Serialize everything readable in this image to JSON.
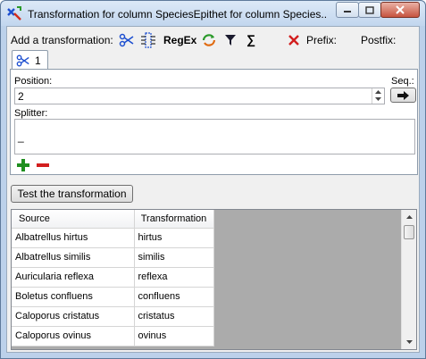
{
  "window": {
    "title": "Transformation for column SpeciesEpithet for column Species..."
  },
  "toolbar": {
    "add_label": "Add a transformation:",
    "icons": [
      "split-icon",
      "insert-column-icon",
      "regex",
      "replace-icon",
      "filter-icon",
      "sum-icon",
      "delete-icon"
    ],
    "regex_label": "RegEx",
    "sum_label": "∑",
    "prefix_label": "Prefix:",
    "postfix_label": "Postfix:"
  },
  "tab": {
    "label": "1"
  },
  "form": {
    "position_label": "Position:",
    "position_value": "2",
    "sequence_label": "Seq.:",
    "splitter_label": "Splitter:",
    "splitter_value": "_"
  },
  "actions": {
    "test_label": "Test the transformation"
  },
  "table": {
    "columns": [
      "Source",
      "Transformation"
    ],
    "rows": [
      [
        "Albatrellus hirtus",
        "hirtus"
      ],
      [
        "Albatrellus similis",
        "similis"
      ],
      [
        "Auricularia reflexa",
        "reflexa"
      ],
      [
        "Boletus confluens",
        "confluens"
      ],
      [
        "Caloporus cristatus",
        "cristatus"
      ],
      [
        "Caloporus ovinus",
        "ovinus"
      ]
    ]
  },
  "colors": {
    "accent_green": "#1f8f1f",
    "accent_red": "#d21e1e",
    "titlebar": "#c2d6ee"
  }
}
